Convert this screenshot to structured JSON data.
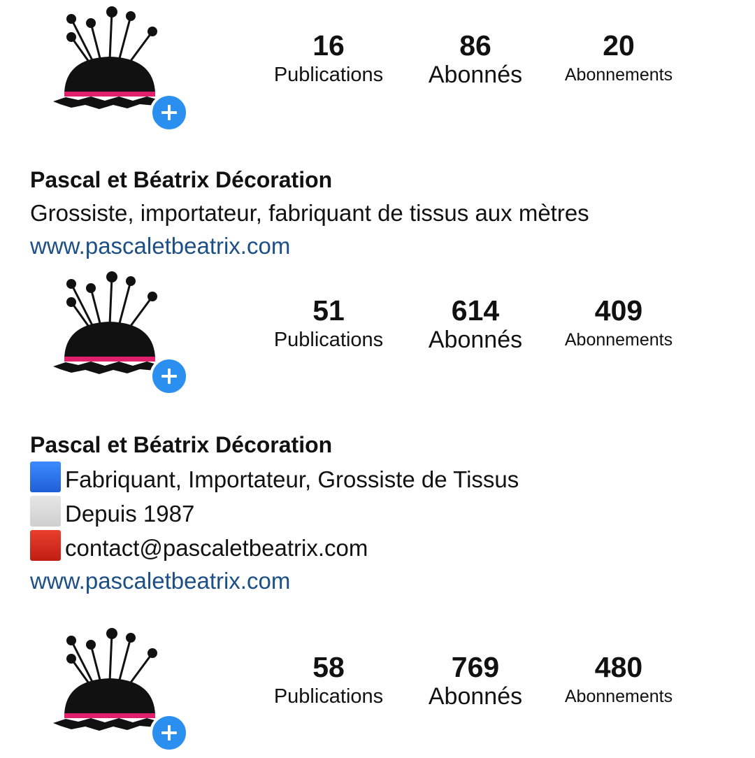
{
  "profiles": [
    {
      "stats": {
        "posts_value": "16",
        "posts_label": "Publications",
        "followers_value": "86",
        "followers_label": "Abonnés",
        "following_value": "20",
        "following_label": "Abonnements"
      },
      "bio": {
        "name": "Pascal et Béatrix Décoration",
        "lines": [
          "Grossiste, importateur, fabriquant de tissus aux mètres"
        ],
        "link": "www.pascaletbeatrix.com"
      }
    },
    {
      "stats": {
        "posts_value": "51",
        "posts_label": "Publications",
        "followers_value": "614",
        "followers_label": "Abonnés",
        "following_value": "409",
        "following_label": "Abonnements"
      },
      "bio": {
        "name": "Pascal et Béatrix Décoration",
        "lines": [
          "Fabriquant, Importateur, Grossiste de Tissus",
          "Depuis 1987",
          "contact@pascaletbeatrix.com"
        ],
        "link": "www.pascaletbeatrix.com"
      }
    },
    {
      "stats": {
        "posts_value": "58",
        "posts_label": "Publications",
        "followers_value": "769",
        "followers_label": "Abonnés",
        "following_value": "480",
        "following_label": "Abonnements"
      }
    }
  ],
  "icons": {
    "avatar": "pincushion-logo",
    "add_badge": "plus-icon",
    "bio_line_markers": [
      "blue-square-icon",
      "white-square-icon",
      "red-square-icon"
    ]
  },
  "colors": {
    "link": "#1c4f86",
    "badge": "#2b8ff0",
    "flag_blue": "#1f6fe8",
    "flag_white": "#d9d9d9",
    "flag_red": "#d7281c",
    "logo_ribbon": "#e0206c"
  }
}
